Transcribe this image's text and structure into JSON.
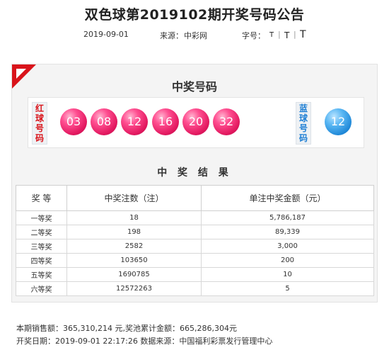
{
  "page": {
    "title": "双色球第2019102期开奖号码公告"
  },
  "meta": {
    "date": "2019-09-01",
    "source_label": "来源：",
    "source_value": "中彩网",
    "font_size_label": "字号：",
    "font_small": "T",
    "font_medium": "T",
    "font_large": "T",
    "separator": "|"
  },
  "draw": {
    "title": "中奖号码",
    "red_label": "红球号码",
    "blue_label": "蓝球号码",
    "red_balls": [
      "03",
      "08",
      "12",
      "16",
      "20",
      "32"
    ],
    "blue_ball": "12",
    "colors": {
      "red_ball": "#e2185f",
      "blue_ball": "#1d86d6",
      "corner": "#d9141b"
    }
  },
  "results": {
    "title": "中 奖 结 果",
    "headers": [
      "奖 等",
      "中奖注数（注）",
      "单注中奖金额（元）"
    ],
    "rows": [
      {
        "level": "一等奖",
        "count": "18",
        "amount": "5,786,187"
      },
      {
        "level": "二等奖",
        "count": "198",
        "amount": "89,339"
      },
      {
        "level": "三等奖",
        "count": "2582",
        "amount": "3,000"
      },
      {
        "level": "四等奖",
        "count": "103650",
        "amount": "200"
      },
      {
        "level": "五等奖",
        "count": "1690785",
        "amount": "10"
      },
      {
        "level": "六等奖",
        "count": "12572263",
        "amount": "5"
      }
    ]
  },
  "footer": {
    "sales_line": "本期销售额：365,310,214 元,奖池累计金额：665,286,304元",
    "draw_line": "开奖日期：2019-09-01 22:17:26 数据来源：中国福利彩票发行管理中心"
  }
}
